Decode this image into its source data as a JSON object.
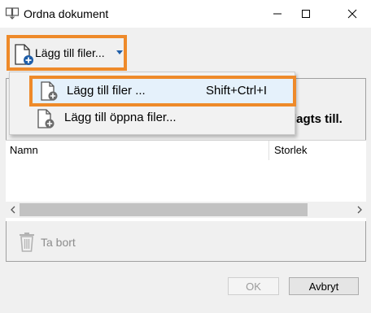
{
  "window": {
    "title": "Ordna dokument",
    "icons": {
      "app": "document-arrange-icon",
      "minimize": "minimize-icon",
      "maximize": "maximize-icon",
      "close": "close-icon"
    }
  },
  "toolbar": {
    "add_files_label": "Lägg till filer...",
    "add_files_icon": "add-file-icon",
    "dropdown_icon": "chevron-down-icon",
    "accent_color": "#1f5ea8",
    "highlight_color": "#ee8a2a"
  },
  "menu": {
    "items": [
      {
        "label": "Lägg till filer ...",
        "shortcut": "Shift+Ctrl+I",
        "icon": "add-file-icon",
        "highlighted": true
      },
      {
        "label": "Lägg till öppna filer...",
        "icon": "add-file-icon",
        "highlighted": false
      }
    ]
  },
  "panel": {
    "hint_text": "lagts till."
  },
  "list": {
    "columns": [
      "Namn",
      "Storlek"
    ],
    "rows": []
  },
  "actions": {
    "delete_label": "Ta bort",
    "delete_icon": "trash-icon"
  },
  "footer": {
    "ok_label": "OK",
    "cancel_label": "Avbryt"
  }
}
